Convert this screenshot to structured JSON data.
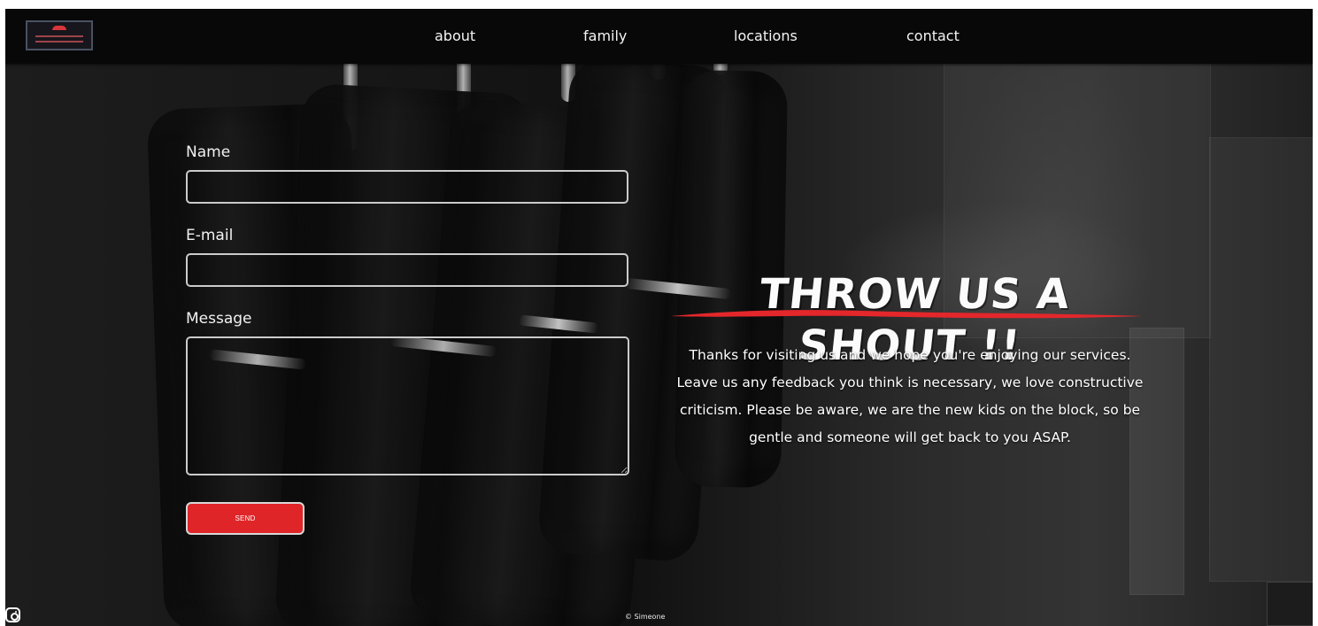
{
  "navigation": {
    "about": "about",
    "family": "family",
    "locations": "locations",
    "contact": "contact"
  },
  "contact_form": {
    "name_label": "Name",
    "email_label": "E-mail",
    "message_label": "Message",
    "name_value": "",
    "email_value": "",
    "message_value": "",
    "send_label": "SEND"
  },
  "hero": {
    "title": "THROW US A SHOUT !!",
    "body": "Thanks for visiting us and we hope you're enjoying our services. Leave us any feedback you think is necessary, we love constructive criticism. Please be aware, we are the new kids on the block, so be gentle and someone will get back to you ASAP."
  },
  "footer": {
    "copyright": "© Simeone"
  },
  "colors": {
    "accent_red": "#df2528",
    "nav_background": "#080808",
    "text": "#ffffff"
  },
  "icons": {
    "instagram": "instagram-icon",
    "logo": "brand-logo"
  }
}
